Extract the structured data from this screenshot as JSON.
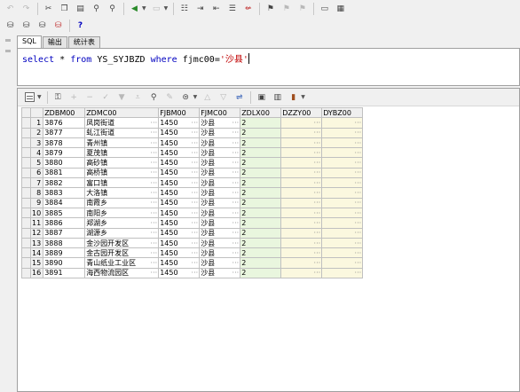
{
  "toolbar1": {
    "icons": [
      "undo-icon",
      "redo-icon",
      "cut-icon",
      "copy-icon",
      "paste-icon",
      "find-icon",
      "find-replace-icon",
      "execute-icon",
      "execute-dropdown",
      "step-icon",
      "format-icon",
      "indent-icon",
      "unindent-icon",
      "comment-icon",
      "uncomment-icon",
      "run-icon",
      "debug-icon",
      "stop-icon",
      "commit-icon",
      "grid-icon"
    ]
  },
  "toolbar2": {
    "help_label": "?"
  },
  "tabs": [
    "SQL",
    "输出",
    "统计表"
  ],
  "sql": {
    "select": "select",
    "star": "*",
    "from": "from",
    "table": "YS_SYJBZD",
    "where": "where",
    "cond_left": "fjmc00=",
    "cond_value": "'沙县'"
  },
  "grid": {
    "columns": [
      "ZDBM00",
      "ZDMC00",
      "FJBM00",
      "FJMC00",
      "ZDLX00",
      "DZZY00",
      "DYBZ00"
    ],
    "ellipsis": "···",
    "rows": [
      {
        "n": "1",
        "zdbm": "3876",
        "zdmc": "凤岗街道",
        "fjbm": "1450",
        "fjmc": "沙县",
        "zdlx": "2"
      },
      {
        "n": "2",
        "zdbm": "3877",
        "zdmc": "虬江街道",
        "fjbm": "1450",
        "fjmc": "沙县",
        "zdlx": "2"
      },
      {
        "n": "3",
        "zdbm": "3878",
        "zdmc": "青州镇",
        "fjbm": "1450",
        "fjmc": "沙县",
        "zdlx": "2"
      },
      {
        "n": "4",
        "zdbm": "3879",
        "zdmc": "夏茂镇",
        "fjbm": "1450",
        "fjmc": "沙县",
        "zdlx": "2"
      },
      {
        "n": "5",
        "zdbm": "3880",
        "zdmc": "高砂镇",
        "fjbm": "1450",
        "fjmc": "沙县",
        "zdlx": "2"
      },
      {
        "n": "6",
        "zdbm": "3881",
        "zdmc": "高桥镇",
        "fjbm": "1450",
        "fjmc": "沙县",
        "zdlx": "2"
      },
      {
        "n": "7",
        "zdbm": "3882",
        "zdmc": "富口镇",
        "fjbm": "1450",
        "fjmc": "沙县",
        "zdlx": "2"
      },
      {
        "n": "8",
        "zdbm": "3883",
        "zdmc": "大洛镇",
        "fjbm": "1450",
        "fjmc": "沙县",
        "zdlx": "2"
      },
      {
        "n": "9",
        "zdbm": "3884",
        "zdmc": "南霞乡",
        "fjbm": "1450",
        "fjmc": "沙县",
        "zdlx": "2"
      },
      {
        "n": "10",
        "zdbm": "3885",
        "zdmc": "南阳乡",
        "fjbm": "1450",
        "fjmc": "沙县",
        "zdlx": "2"
      },
      {
        "n": "11",
        "zdbm": "3886",
        "zdmc": "郑湖乡",
        "fjbm": "1450",
        "fjmc": "沙县",
        "zdlx": "2"
      },
      {
        "n": "12",
        "zdbm": "3887",
        "zdmc": "湖源乡",
        "fjbm": "1450",
        "fjmc": "沙县",
        "zdlx": "2"
      },
      {
        "n": "13",
        "zdbm": "3888",
        "zdmc": "金沙园开发区",
        "fjbm": "1450",
        "fjmc": "沙县",
        "zdlx": "2"
      },
      {
        "n": "14",
        "zdbm": "3889",
        "zdmc": "金古园开发区",
        "fjbm": "1450",
        "fjmc": "沙县",
        "zdlx": "2"
      },
      {
        "n": "15",
        "zdbm": "3890",
        "zdmc": "青山纸业工业区",
        "fjbm": "1450",
        "fjmc": "沙县",
        "zdlx": "2"
      },
      {
        "n": "16",
        "zdbm": "3891",
        "zdmc": "海西物流园区",
        "fjbm": "1450",
        "fjmc": "沙县",
        "zdlx": "2"
      }
    ]
  }
}
